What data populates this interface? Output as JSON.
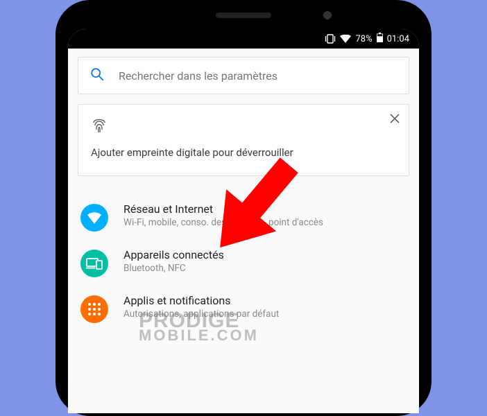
{
  "status": {
    "battery": "78%",
    "time": "01:04"
  },
  "search": {
    "placeholder": "Rechercher dans les paramètres"
  },
  "fingerprint_card": {
    "text": "Ajouter empreinte digitale pour déverrouiller"
  },
  "settings": [
    {
      "title": "Réseau et Internet",
      "subtitle": "Wi-Fi, mobile, conso. des données, point d'accès",
      "icon": "network",
      "color": "#00b0ff"
    },
    {
      "title": "Appareils connectés",
      "subtitle": "Bluetooth, NFC",
      "icon": "devices",
      "color": "#00bfa5"
    },
    {
      "title": "Applis et notifications",
      "subtitle": "Autorisations, applications par défaut",
      "icon": "apps",
      "color": "#ff6d00"
    }
  ],
  "watermark": {
    "line1": "PRODIGE",
    "line2": "MOBILE.COM"
  }
}
